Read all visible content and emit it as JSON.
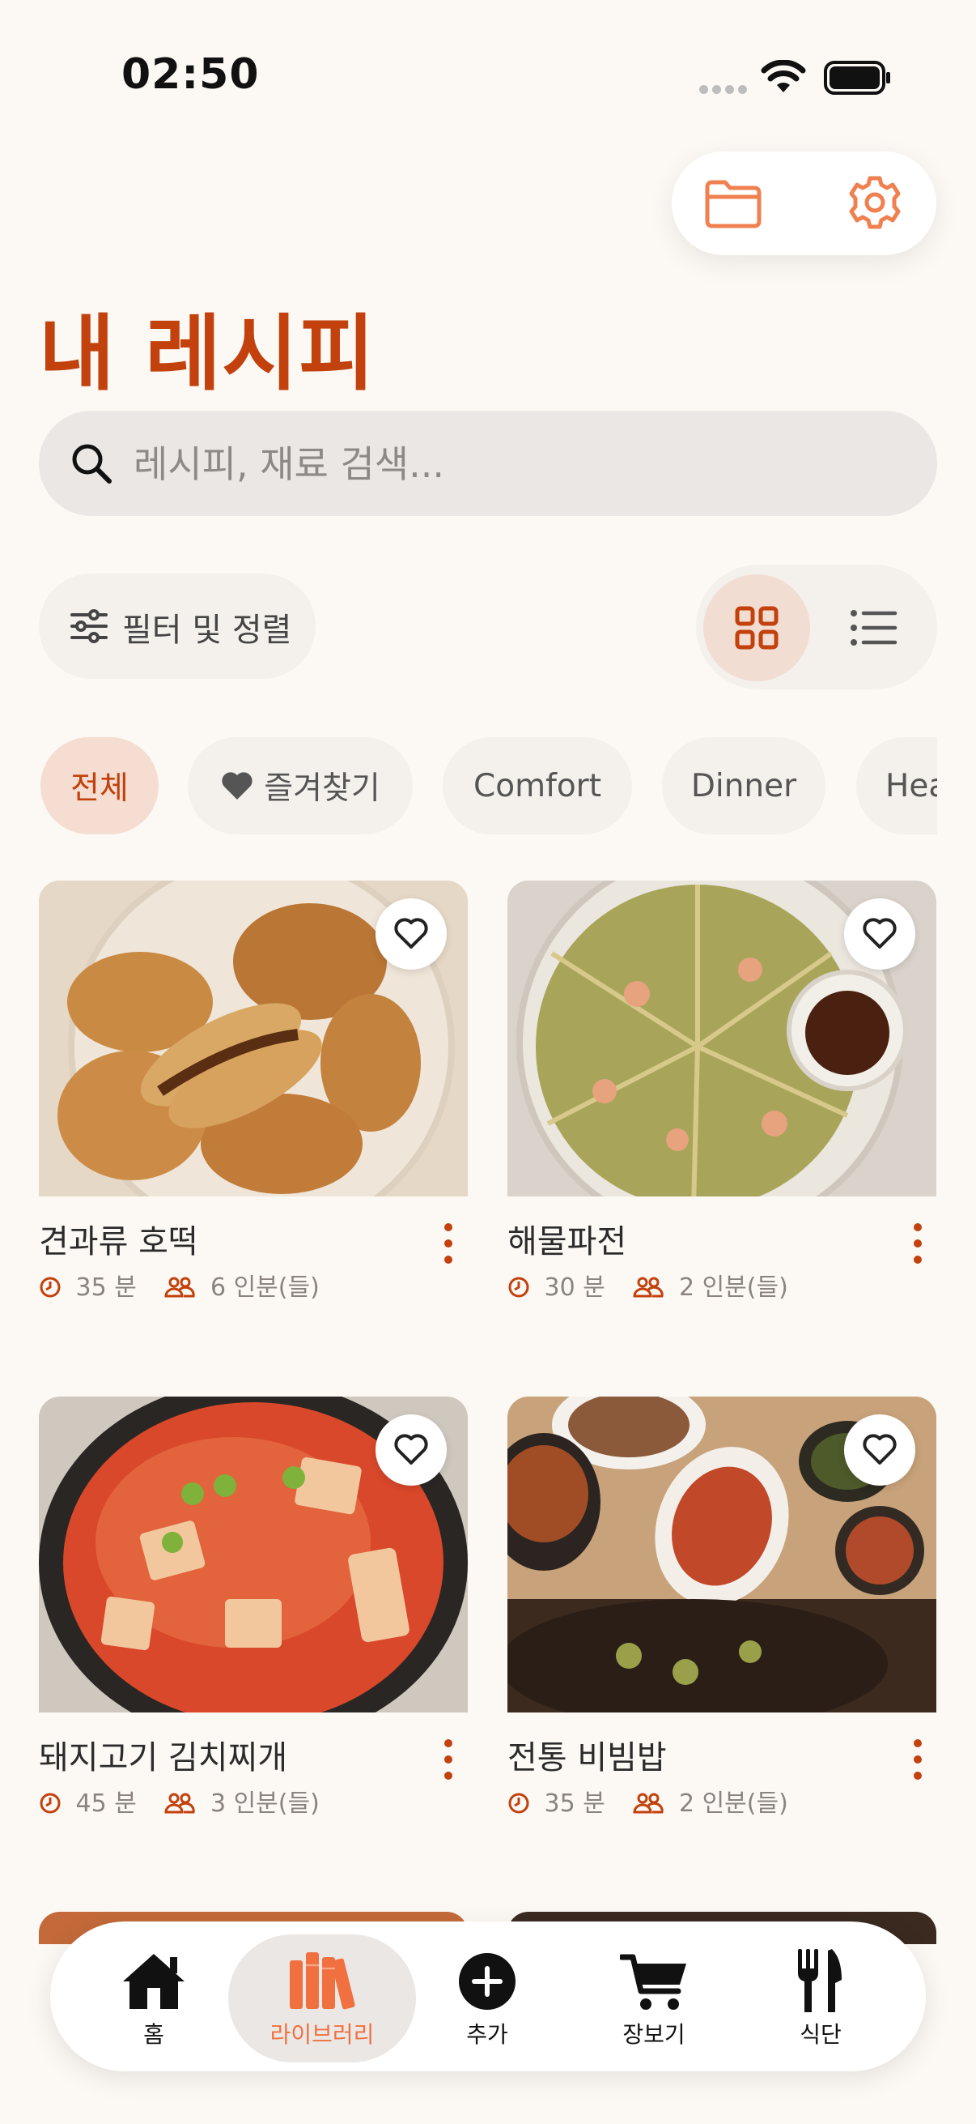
{
  "status_bar": {
    "time": "02:50"
  },
  "header": {
    "title": "내 레시피"
  },
  "search": {
    "placeholder": "레시피, 재료 검색..."
  },
  "toolbar": {
    "filter_label": "필터 및 정렬"
  },
  "chips": [
    {
      "label": "전체",
      "active": true
    },
    {
      "label": "즐겨찾기",
      "icon": "heart-icon"
    },
    {
      "label": "Comfort"
    },
    {
      "label": "Dinner"
    },
    {
      "label": "Hea"
    }
  ],
  "recipes": [
    {
      "title": "견과류 호떡",
      "time": "35 분",
      "servings": "6 인분(들)"
    },
    {
      "title": "해물파전",
      "time": "30 분",
      "servings": "2 인분(들)"
    },
    {
      "title": "돼지고기 김치찌개",
      "time": "45 분",
      "servings": "3 인분(들)"
    },
    {
      "title": "전통 비빔밥",
      "time": "35 분",
      "servings": "2 인분(들)"
    }
  ],
  "nav": {
    "home": "홈",
    "library": "라이브러리",
    "add": "추가",
    "shopping": "장보기",
    "meal": "식단"
  },
  "colors": {
    "accent": "#c2410c",
    "accent_light": "#f08050",
    "background": "#fcf9f5"
  }
}
